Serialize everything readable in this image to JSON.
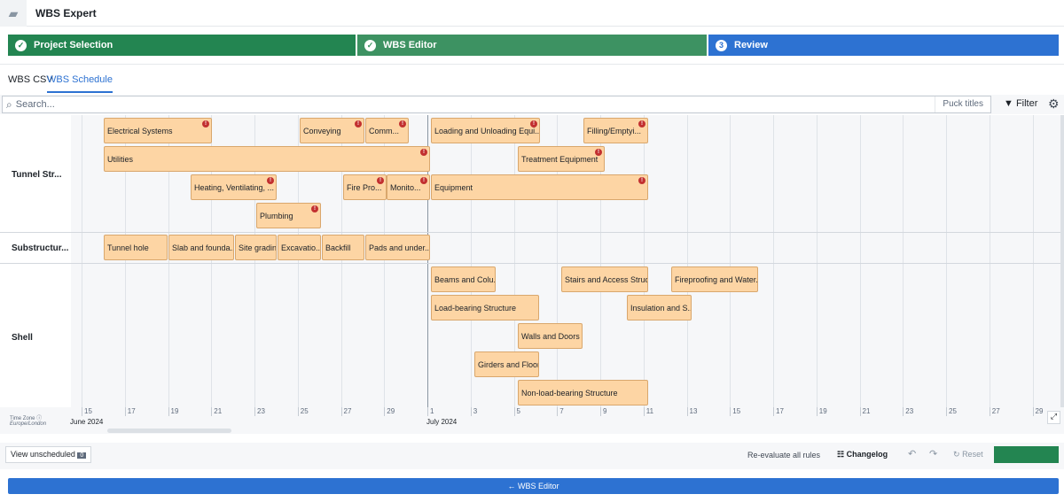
{
  "app": {
    "title": "WBS Expert",
    "icon": "chat-icon"
  },
  "steps": [
    {
      "label": "Project Selection",
      "status": "done"
    },
    {
      "label": "WBS Editor",
      "status": "done"
    },
    {
      "label": "Review",
      "number": "3",
      "status": "current"
    }
  ],
  "colors": {
    "done": "#238551",
    "done2": "#3d9262",
    "current": "#2d72d2",
    "puck": "#fdd5a4",
    "warning": "#c23030"
  },
  "tabs": [
    {
      "label": "WBS CSV",
      "active": false
    },
    {
      "label": "WBS Schedule",
      "active": true
    }
  ],
  "search": {
    "placeholder": "Search...",
    "puck_titles": "Puck titles",
    "filter": "Filter"
  },
  "groups": [
    {
      "label": "Tunnel Str..."
    },
    {
      "label": "Substructur..."
    },
    {
      "label": "Shell"
    }
  ],
  "tasks": [
    {
      "name": "Electrical Systems",
      "warning": true
    },
    {
      "name": "Conveying",
      "warning": true
    },
    {
      "name": "Comm...",
      "warning": true
    },
    {
      "name": "Loading and Unloading Equi...",
      "warning": true
    },
    {
      "name": "Filling/Emptyi...",
      "warning": true
    },
    {
      "name": "Utilities",
      "warning": true
    },
    {
      "name": "Treatment Equipment",
      "warning": true
    },
    {
      "name": "Heating, Ventilating, ...",
      "warning": true
    },
    {
      "name": "Fire Pro...",
      "warning": true
    },
    {
      "name": "Monito...",
      "warning": true
    },
    {
      "name": "Equipment",
      "warning": true
    },
    {
      "name": "Plumbing",
      "warning": true
    },
    {
      "name": "Tunnel hole",
      "warning": false
    },
    {
      "name": "Slab and founda...",
      "warning": false
    },
    {
      "name": "Site grading",
      "warning": false
    },
    {
      "name": "Excavatio...",
      "warning": false
    },
    {
      "name": "Backfill",
      "warning": false
    },
    {
      "name": "Pads and under...",
      "warning": false
    },
    {
      "name": "Beams and Colu...",
      "warning": false
    },
    {
      "name": "Stairs and Access Struct...",
      "warning": false
    },
    {
      "name": "Fireproofing and Water...",
      "warning": false
    },
    {
      "name": "Load-bearing Structure",
      "warning": false
    },
    {
      "name": "Insulation and S...",
      "warning": false
    },
    {
      "name": "Walls and Doors",
      "warning": false
    },
    {
      "name": "Girders and Floors",
      "warning": false
    },
    {
      "name": "Non-load-bearing Structure",
      "warning": false
    }
  ],
  "axis": {
    "ticks": [
      "15",
      "17",
      "19",
      "21",
      "23",
      "25",
      "27",
      "29",
      "1",
      "3",
      "5",
      "7",
      "9",
      "11",
      "13",
      "15",
      "17",
      "19",
      "21",
      "23",
      "25",
      "27",
      "29"
    ],
    "months": [
      "June 2024",
      "July 2024"
    ]
  },
  "timezone": {
    "label": "Time Zone",
    "value": "Europe/London"
  },
  "footer": {
    "view_unscheduled": "View unscheduled",
    "unscheduled_count": "0",
    "reevaluate": "Re-evaluate all rules",
    "changelog": "Changelog",
    "reset": "Reset",
    "back": "← WBS Editor"
  }
}
